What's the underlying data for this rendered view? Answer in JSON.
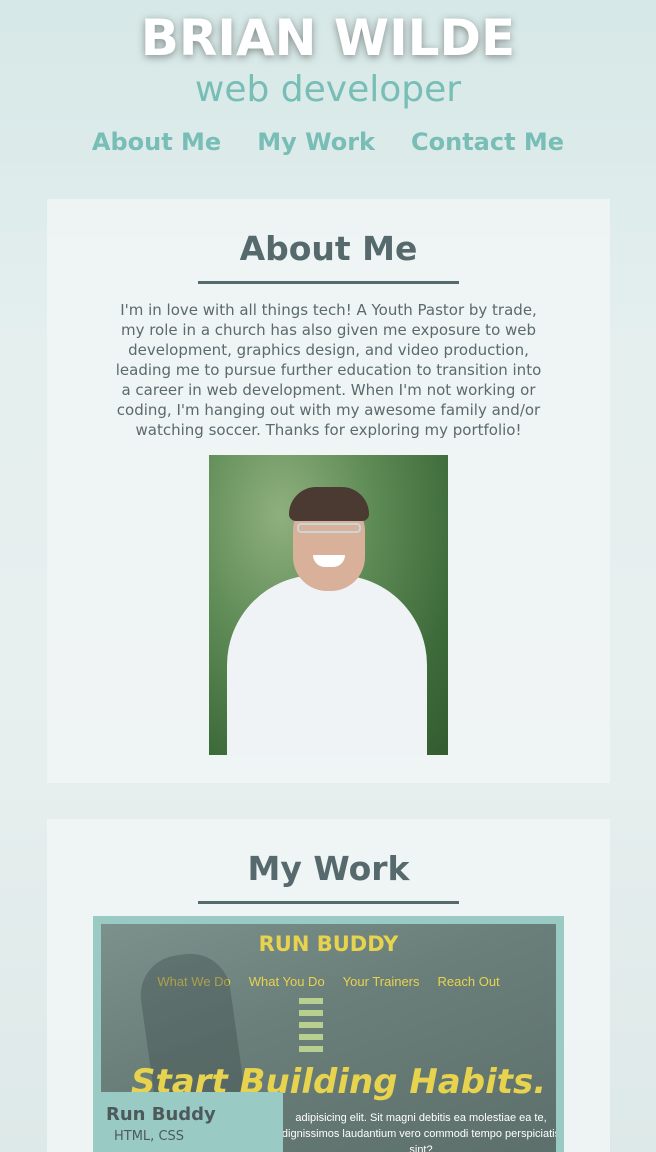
{
  "header": {
    "name": "BRIAN WILDE",
    "subtitle": "web developer",
    "nav": [
      "About Me",
      "My Work",
      "Contact Me"
    ]
  },
  "about": {
    "heading": "About Me",
    "bio": "I'm in love with all things tech! A Youth Pastor by trade, my role in a church has also given me exposure to web development, graphics design, and video production, leading me to pursue further education to transition into a career in web development. When I'm not working or coding, I'm hanging out with my awesome family and/or watching soccer. Thanks for exploring my portfolio!"
  },
  "work": {
    "heading": "My Work",
    "projects": [
      {
        "name": "Run Buddy",
        "tech": "HTML, CSS",
        "screenshot": {
          "title": "RUN BUDDY",
          "nav": [
            "What We Do",
            "What You Do",
            "Your Trainers",
            "Reach Out"
          ],
          "hero": "Start Building Habits.",
          "body": "adipisicing elit. Sit magni debitis ea molestiae ea te, dignissimos laudantium vero commodi tempo perspiciatis sint?"
        }
      }
    ]
  },
  "colors": {
    "accent": "#78bdb6",
    "heading": "#566a6d",
    "project_bg": "#9acac4"
  }
}
